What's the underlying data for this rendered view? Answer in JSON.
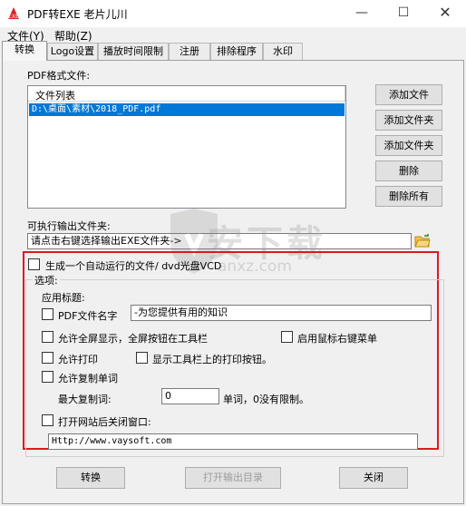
{
  "window": {
    "title": "PDF转EXE   老片儿川",
    "min_symbol": "—",
    "max_symbol": "☐",
    "close_symbol": "✕"
  },
  "menu": [
    "文件(Y)",
    "帮助(Z)"
  ],
  "tabs": [
    "转换",
    "Logo设置",
    "播放时间限制",
    "注册",
    "排除程序",
    "水印"
  ],
  "active_tab": 0,
  "pdf_section": {
    "label": "PDF格式文件:",
    "list_header": "文件列表",
    "files": [
      "D:\\桌面\\素材\\2018_PDF.pdf"
    ]
  },
  "side_buttons": [
    "添加文件",
    "添加文件夹",
    "添加文件夹",
    "删除",
    "删除所有"
  ],
  "output": {
    "label": "可执行输出文件夹:",
    "value": "请点击右键选择输出EXE文件夹->",
    "folder_icon": "folder-icon"
  },
  "autorun_checkbox": {
    "label": "生成一个自动运行的文件/ dvd光盘VCD",
    "checked": false
  },
  "options": {
    "title": "选项:",
    "app_title_label": "应用标题:",
    "pdf_name": {
      "label": "PDF文件名字",
      "checked": false,
      "value": "-为您提供有用的知识"
    },
    "fullscreen": {
      "label": "允许全屏显示，全屏按钮在工具栏",
      "checked": false
    },
    "right_click": {
      "label": "启用鼠标右键菜单",
      "checked": false
    },
    "allow_print": {
      "label": "允许打印",
      "checked": false
    },
    "show_print_btn": {
      "label": "显示工具栏上的打印按钮。",
      "checked": false
    },
    "allow_copy": {
      "label": "允许复制单词",
      "checked": false
    },
    "max_copy_label": "最大复制词:",
    "max_copy_value": "0",
    "max_copy_suffix": "单词，0没有限制。",
    "close_after_site": {
      "label": "打开网站后关闭窗口:",
      "checked": false
    },
    "url": "Http://www.vaysoft.com"
  },
  "bottom_buttons": {
    "convert": "转换",
    "open_output": "打开输出目录",
    "close": "关闭"
  },
  "watermark": {
    "text": "安下载",
    "sub": "anxz.com"
  },
  "colors": {
    "highlight": "#e2171e",
    "selection": "#0078d7"
  }
}
